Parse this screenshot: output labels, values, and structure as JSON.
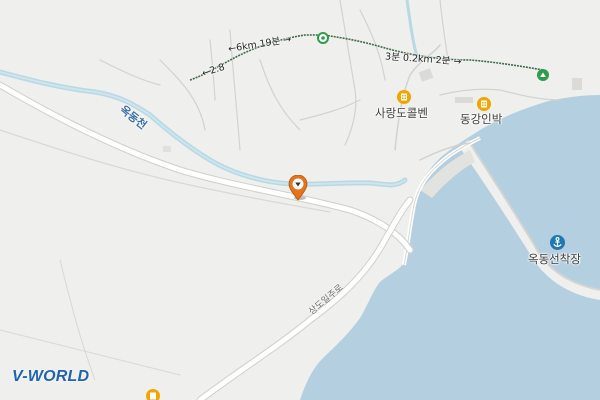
{
  "map": {
    "type": "street-map",
    "colors": {
      "land": "#efefed",
      "water": "#b4cfe0",
      "stream": "#b7d9e4",
      "road_edge": "#c9c9c9",
      "road": "#ffffff",
      "hotel_icon": "#f2a500",
      "marker": "#e8731a",
      "trail_icon": "#2e9e4a",
      "logo": "#1e63b6"
    }
  },
  "labels": {
    "pois": {
      "pension_1": "사랑도콜벤",
      "pension_2": "동강인박",
      "harbor": "옥동선착장"
    },
    "stream": "옥동천",
    "road": "상도일주로",
    "trail_segments": {
      "seg_a": "←6km 19분 →",
      "seg_b": "←2.8",
      "seg_c": "3분 0.2km 2분 →"
    }
  },
  "icons": {
    "pension_1": "hotel-icon",
    "pension_2": "hotel-icon",
    "pension_3": "hotel-icon",
    "harbor": "anchor-icon",
    "trail_start": "trail-node-icon",
    "trail_end": "trail-end-icon",
    "location": "location-pin-icon"
  },
  "logo": "V-WORLD"
}
